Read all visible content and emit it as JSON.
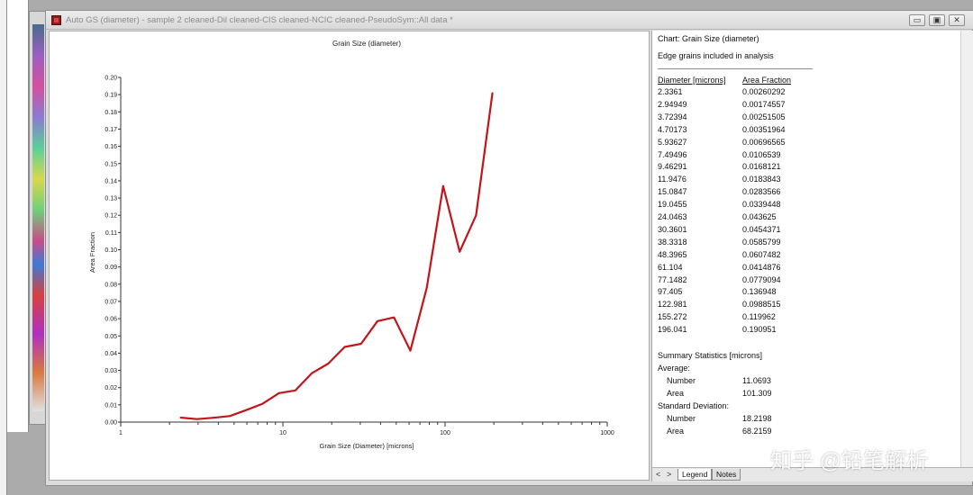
{
  "window": {
    "title": "Auto GS (diameter) - sample 2 cleaned-Dil cleaned-CIS cleaned-NCIC cleaned-PseudoSym::All data *",
    "min_glyph": "▭",
    "max_glyph": "▣",
    "close_glyph": "✕"
  },
  "chart_data": {
    "type": "line",
    "title": "Grain Size (diameter)",
    "xlabel": "Grain Size (Diameter) [microns]",
    "ylabel": "Area Fraction",
    "xscale": "log",
    "xlim": [
      1,
      1000
    ],
    "ylim": [
      0,
      0.2
    ],
    "x_ticks": [
      "1",
      "10",
      "100",
      "1000"
    ],
    "y_ticks": [
      "0.00",
      "0.01",
      "0.02",
      "0.03",
      "0.04",
      "0.05",
      "0.06",
      "0.07",
      "0.08",
      "0.09",
      "0.10",
      "0.11",
      "0.12",
      "0.13",
      "0.14",
      "0.15",
      "0.16",
      "0.17",
      "0.18",
      "0.19",
      "0.20"
    ],
    "line_color": "#c0161b",
    "series": [
      {
        "x": [
          2.3361,
          2.94949,
          3.72394,
          4.70173,
          5.93627,
          7.49496,
          9.46291,
          11.9476,
          15.0847,
          19.0455,
          24.0463,
          30.3601,
          38.3318,
          48.3965,
          61.104,
          77.1482,
          97.405,
          122.981,
          155.272,
          196.041
        ],
        "y": [
          0.00260292,
          0.00174557,
          0.00251505,
          0.00351964,
          0.00696565,
          0.0106539,
          0.0168121,
          0.0183843,
          0.0283566,
          0.0339448,
          0.043625,
          0.0454371,
          0.0585799,
          0.0607482,
          0.0414876,
          0.0779094,
          0.136948,
          0.0988515,
          0.119962,
          0.190951
        ]
      }
    ]
  },
  "info": {
    "chart_line": "Chart: Grain Size (diameter)",
    "edge_note": "Edge grains included in analysis",
    "col_diameter": "Diameter [microns]",
    "col_area": "Area Fraction",
    "rows": [
      {
        "d": "2.3361",
        "a": "0.00260292"
      },
      {
        "d": "2.94949",
        "a": "0.00174557"
      },
      {
        "d": "3.72394",
        "a": "0.00251505"
      },
      {
        "d": "4.70173",
        "a": "0.00351964"
      },
      {
        "d": "5.93627",
        "a": "0.00696565"
      },
      {
        "d": "7.49496",
        "a": "0.0106539"
      },
      {
        "d": "9.46291",
        "a": "0.0168121"
      },
      {
        "d": "11.9476",
        "a": "0.0183843"
      },
      {
        "d": "15.0847",
        "a": "0.0283566"
      },
      {
        "d": "19.0455",
        "a": "0.0339448"
      },
      {
        "d": "24.0463",
        "a": "0.043625"
      },
      {
        "d": "30.3601",
        "a": "0.0454371"
      },
      {
        "d": "38.3318",
        "a": "0.0585799"
      },
      {
        "d": "48.3965",
        "a": "0.0607482"
      },
      {
        "d": "61.104",
        "a": "0.0414876"
      },
      {
        "d": "77.1482",
        "a": "0.0779094"
      },
      {
        "d": "97.405",
        "a": "0.136948"
      },
      {
        "d": "122.981",
        "a": "0.0988515"
      },
      {
        "d": "155.272",
        "a": "0.119962"
      },
      {
        "d": "196.041",
        "a": "0.190951"
      }
    ],
    "summary_title": "Summary Statistics [microns]",
    "average_label": "Average:",
    "avg_number_label": "Number",
    "avg_number_value": "11.0693",
    "avg_area_label": "Area",
    "avg_area_value": "101.309",
    "std_label": "Standard Deviation:",
    "std_number_label": "Number",
    "std_number_value": "18.2198",
    "std_area_label": "Area",
    "std_area_value": "68.2159"
  },
  "tabs": {
    "prev": "<",
    "next": ">",
    "legend": "Legend",
    "notes": "Notes"
  },
  "watermark": "知乎 @铅笔解析"
}
